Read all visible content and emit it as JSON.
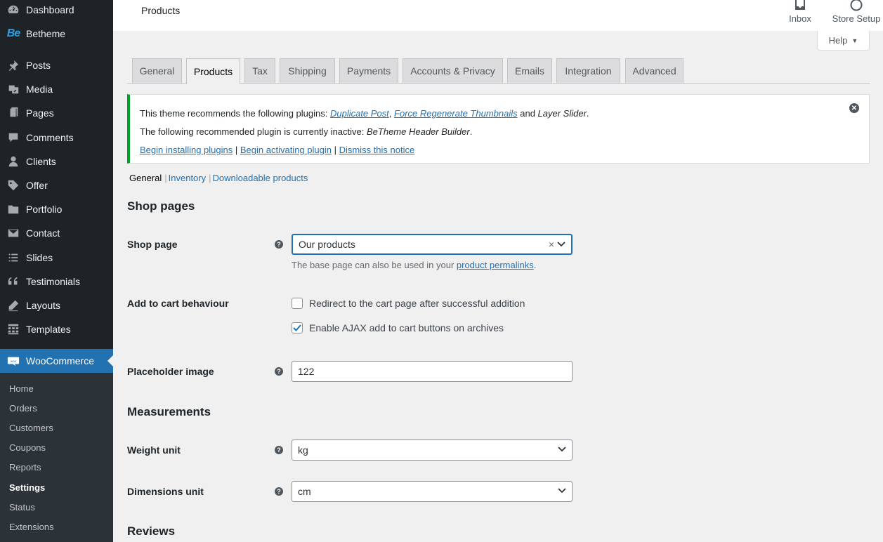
{
  "sidebar": {
    "items": [
      {
        "label": "Dashboard",
        "icon": "dashboard-icon"
      },
      {
        "label": "Betheme",
        "icon": "betheme-logo-icon"
      },
      {
        "label": "Posts",
        "icon": "pin-icon"
      },
      {
        "label": "Media",
        "icon": "media-icon"
      },
      {
        "label": "Pages",
        "icon": "pages-icon"
      },
      {
        "label": "Comments",
        "icon": "comment-icon"
      },
      {
        "label": "Clients",
        "icon": "user-icon"
      },
      {
        "label": "Offer",
        "icon": "tag-icon"
      },
      {
        "label": "Portfolio",
        "icon": "folder-icon"
      },
      {
        "label": "Contact",
        "icon": "mail-icon"
      },
      {
        "label": "Slides",
        "icon": "list-icon"
      },
      {
        "label": "Testimonials",
        "icon": "quote-icon"
      },
      {
        "label": "Layouts",
        "icon": "pencil-icon"
      },
      {
        "label": "Templates",
        "icon": "grid-icon"
      },
      {
        "label": "WooCommerce",
        "icon": "woo-icon"
      }
    ],
    "submenu": [
      {
        "label": "Home"
      },
      {
        "label": "Orders"
      },
      {
        "label": "Customers"
      },
      {
        "label": "Coupons"
      },
      {
        "label": "Reports"
      },
      {
        "label": "Settings"
      },
      {
        "label": "Status"
      },
      {
        "label": "Extensions"
      }
    ],
    "betheme_logo_text": "Be"
  },
  "header": {
    "title": "Products",
    "inbox_label": "Inbox",
    "store_setup_label": "Store Setup",
    "help_label": "Help"
  },
  "tabs": [
    "General",
    "Products",
    "Tax",
    "Shipping",
    "Payments",
    "Accounts & Privacy",
    "Emails",
    "Integration",
    "Advanced"
  ],
  "notice": {
    "line1_prefix": "This theme recommends the following plugins: ",
    "plugin1": "Duplicate Post",
    "comma": ", ",
    "plugin2": "Force Regenerate Thumbnails",
    "and": " and ",
    "plugin3": "Layer Slider",
    "line1_suffix": ".",
    "line2_prefix": "The following recommended plugin is currently inactive: ",
    "plugin4": "BeTheme Header Builder",
    "line2_suffix": ".",
    "link_install": "Begin installing plugins",
    "link_activate": "Begin activating plugin",
    "link_dismiss": "Dismiss this notice",
    "separator": " | "
  },
  "subsections": {
    "current": "General",
    "inventory": "Inventory",
    "downloadable": "Downloadable products",
    "separator": "|"
  },
  "shop_pages": {
    "heading": "Shop pages",
    "shop_page_label": "Shop page",
    "shop_page_value": "Our products",
    "shop_page_desc_prefix": "The base page can also be used in your ",
    "shop_page_desc_link": "product permalinks",
    "shop_page_desc_suffix": ".",
    "add_to_cart_label": "Add to cart behaviour",
    "redirect_label": "Redirect to the cart page after successful addition",
    "redirect_checked": false,
    "ajax_label": "Enable AJAX add to cart buttons on archives",
    "ajax_checked": true,
    "placeholder_label": "Placeholder image",
    "placeholder_value": "122"
  },
  "measurements": {
    "heading": "Measurements",
    "weight_label": "Weight unit",
    "weight_value": "kg",
    "dimensions_label": "Dimensions unit",
    "dimensions_value": "cm"
  },
  "reviews": {
    "heading": "Reviews"
  },
  "colors": {
    "sidebar_bg": "#1d2327",
    "accent": "#2271b1",
    "notice_success": "#00a32a"
  }
}
